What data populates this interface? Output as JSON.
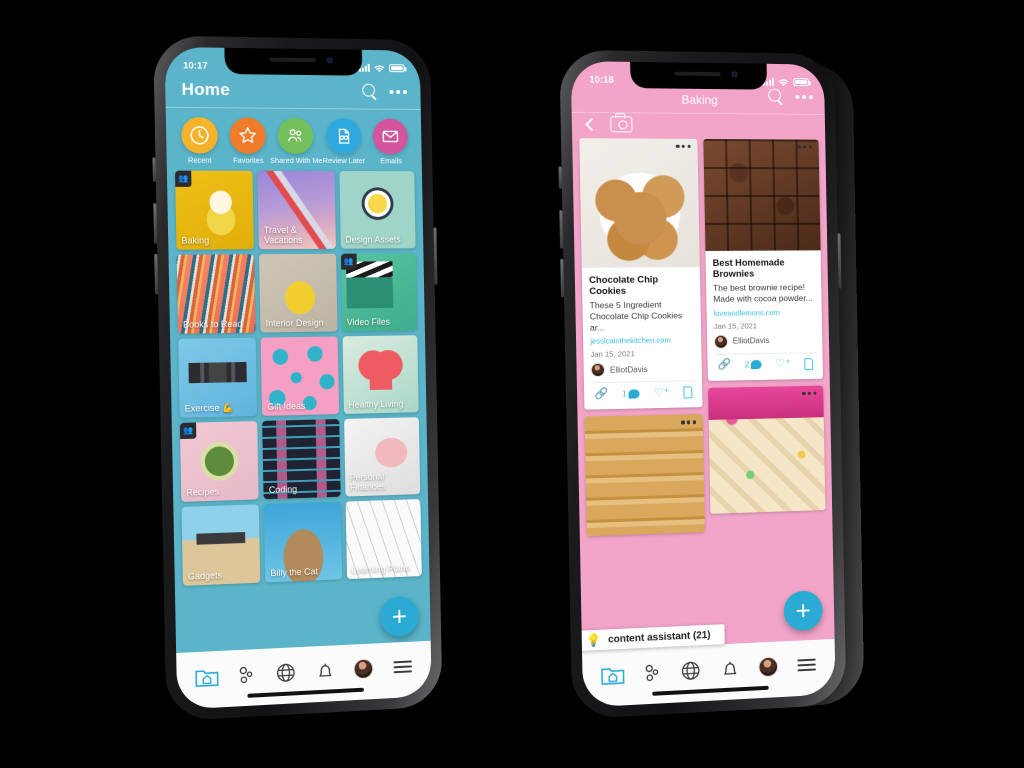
{
  "left_phone": {
    "status": {
      "time": "10:17",
      "signal_icon": "signal-bars-icon",
      "wifi_icon": "wifi-icon",
      "battery_icon": "battery-icon"
    },
    "header": {
      "title": "Home",
      "search_icon": "search-icon",
      "more_icon": "more-dots-icon"
    },
    "quick_actions": [
      {
        "label": "Recent",
        "icon": "clock-icon",
        "color": "#F5B32C"
      },
      {
        "label": "Favorites",
        "icon": "star-icon",
        "color": "#F07B28"
      },
      {
        "label": "Shared With Me",
        "icon": "people-icon",
        "color": "#73C05B"
      },
      {
        "label": "Review Later",
        "icon": "document-glasses-icon",
        "color": "#2FA8DE"
      },
      {
        "label": "Emails",
        "icon": "envelope-icon",
        "color": "#D2559E"
      }
    ],
    "folders": [
      {
        "label": "Baking",
        "shared": true
      },
      {
        "label": "Travel & Vacations",
        "shared": false
      },
      {
        "label": "Design Assets",
        "shared": false
      },
      {
        "label": "Books to Read",
        "shared": false
      },
      {
        "label": "Interior Design",
        "shared": false
      },
      {
        "label": "Video Files",
        "shared": true
      },
      {
        "label": "Exercise 💪",
        "shared": false
      },
      {
        "label": "Gift Ideas",
        "shared": false
      },
      {
        "label": "Healthy Living",
        "shared": false
      },
      {
        "label": "Recipes",
        "shared": true
      },
      {
        "label": "Coding",
        "shared": false
      },
      {
        "label": "Personal Finances",
        "shared": false
      },
      {
        "label": "Gadgets",
        "shared": false
      },
      {
        "label": "Billy the Cat",
        "shared": false
      },
      {
        "label": "Learning Piano",
        "shared": false
      }
    ],
    "fab_label": "+",
    "bottom_nav": [
      {
        "name": "home-folder-icon",
        "active": true
      },
      {
        "name": "connections-icon",
        "active": false
      },
      {
        "name": "globe-icon",
        "active": false
      },
      {
        "name": "bell-icon",
        "active": false
      },
      {
        "name": "profile-avatar",
        "active": false
      },
      {
        "name": "menu-icon",
        "active": false
      }
    ]
  },
  "right_phone": {
    "status": {
      "time": "10:18",
      "signal_icon": "signal-bars-icon",
      "wifi_icon": "wifi-icon",
      "battery_icon": "battery-icon"
    },
    "header": {
      "title": "Baking",
      "search_icon": "search-icon",
      "more_icon": "more-dots-icon",
      "back_icon": "back-chevron-icon",
      "camera_icon": "camera-icon"
    },
    "cards": [
      {
        "title": "Chocolate Chip Cookies",
        "desc": "These 5 Ingredient Chocolate Chip Cookies ar...",
        "source": "jessicainthekitchen.com",
        "date": "Jan 15, 2021",
        "user": "ElliotDavis",
        "comments": "1"
      },
      {
        "title": "Best Homemade Brownies",
        "desc": "The best brownie recipe! Made with cocoa powder...",
        "source": "loveandlemons.com",
        "date": "Jan 15, 2021",
        "user": "ElliotDavis",
        "comments": "2"
      }
    ],
    "assistant": {
      "label": "content assistant (21)",
      "icon": "lightbulb-icon"
    },
    "fab_label": "+",
    "bottom_nav": [
      {
        "name": "home-folder-icon",
        "active": true
      },
      {
        "name": "connections-icon",
        "active": false
      },
      {
        "name": "globe-icon",
        "active": false
      },
      {
        "name": "bell-icon",
        "active": false
      },
      {
        "name": "profile-avatar",
        "active": false
      },
      {
        "name": "menu-icon",
        "active": false
      }
    ]
  },
  "theme": {
    "teal": "#5BB4C9",
    "pink": "#F2A4C9",
    "accent_cyan": "#29ABD4",
    "link_blue": "#3FC0E8"
  }
}
